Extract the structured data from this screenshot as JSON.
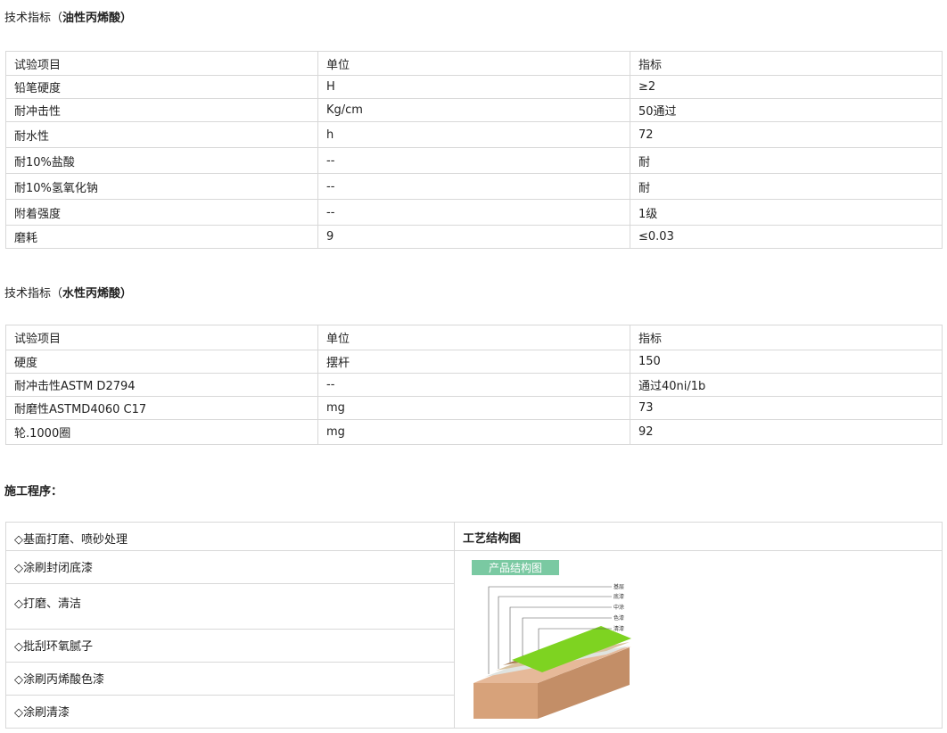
{
  "oil": {
    "heading_prefix": "技术指标（",
    "heading_bold": "油性丙烯酸",
    "heading_suffix": "）",
    "rows": [
      [
        "试验项目",
        "单位",
        "指标"
      ],
      [
        "铅笔硬度",
        "H",
        "≥2"
      ],
      [
        "耐冲击性",
        "Kg/cm",
        "50通过"
      ],
      [
        "耐水性",
        "h",
        "72"
      ],
      [
        "耐10%盐酸",
        "--",
        "耐"
      ],
      [
        "耐10%氢氧化钠",
        "--",
        "耐"
      ],
      [
        "附着强度",
        "--",
        "1级"
      ],
      [
        "磨耗",
        "9",
        "≤0.03"
      ]
    ]
  },
  "water": {
    "heading_prefix": "技术指标（",
    "heading_bold": "水性丙烯酸",
    "heading_suffix": "）",
    "rows": [
      [
        "试验项目",
        "单位",
        "指标"
      ],
      [
        "硬度",
        "摆杆",
        "150"
      ],
      [
        "耐冲击性ASTM D2794",
        "--",
        "通过40ni/1b"
      ],
      [
        "耐磨性ASTMD4060 C17",
        "mg",
        "73"
      ],
      [
        "轮.1000圈",
        "mg",
        "92"
      ]
    ]
  },
  "process": {
    "heading": "施工程序：",
    "steps": [
      "◇基面打磨、喷砂处理",
      "◇涂刷封闭底漆",
      "◇打磨、清洁",
      "◇批刮环氧腻子",
      "◇涂刷丙烯酸色漆",
      "◇涂刷清漆"
    ],
    "diagram_title": "工艺结构图",
    "diagram": {
      "banner": "产品结构图",
      "labels": [
        "基层",
        "底漆",
        "中涂",
        "色漆",
        "清漆"
      ],
      "colors": {
        "banner": "#7ac9a2",
        "top": "#7ed321",
        "soil": "#e3b48f"
      }
    }
  }
}
